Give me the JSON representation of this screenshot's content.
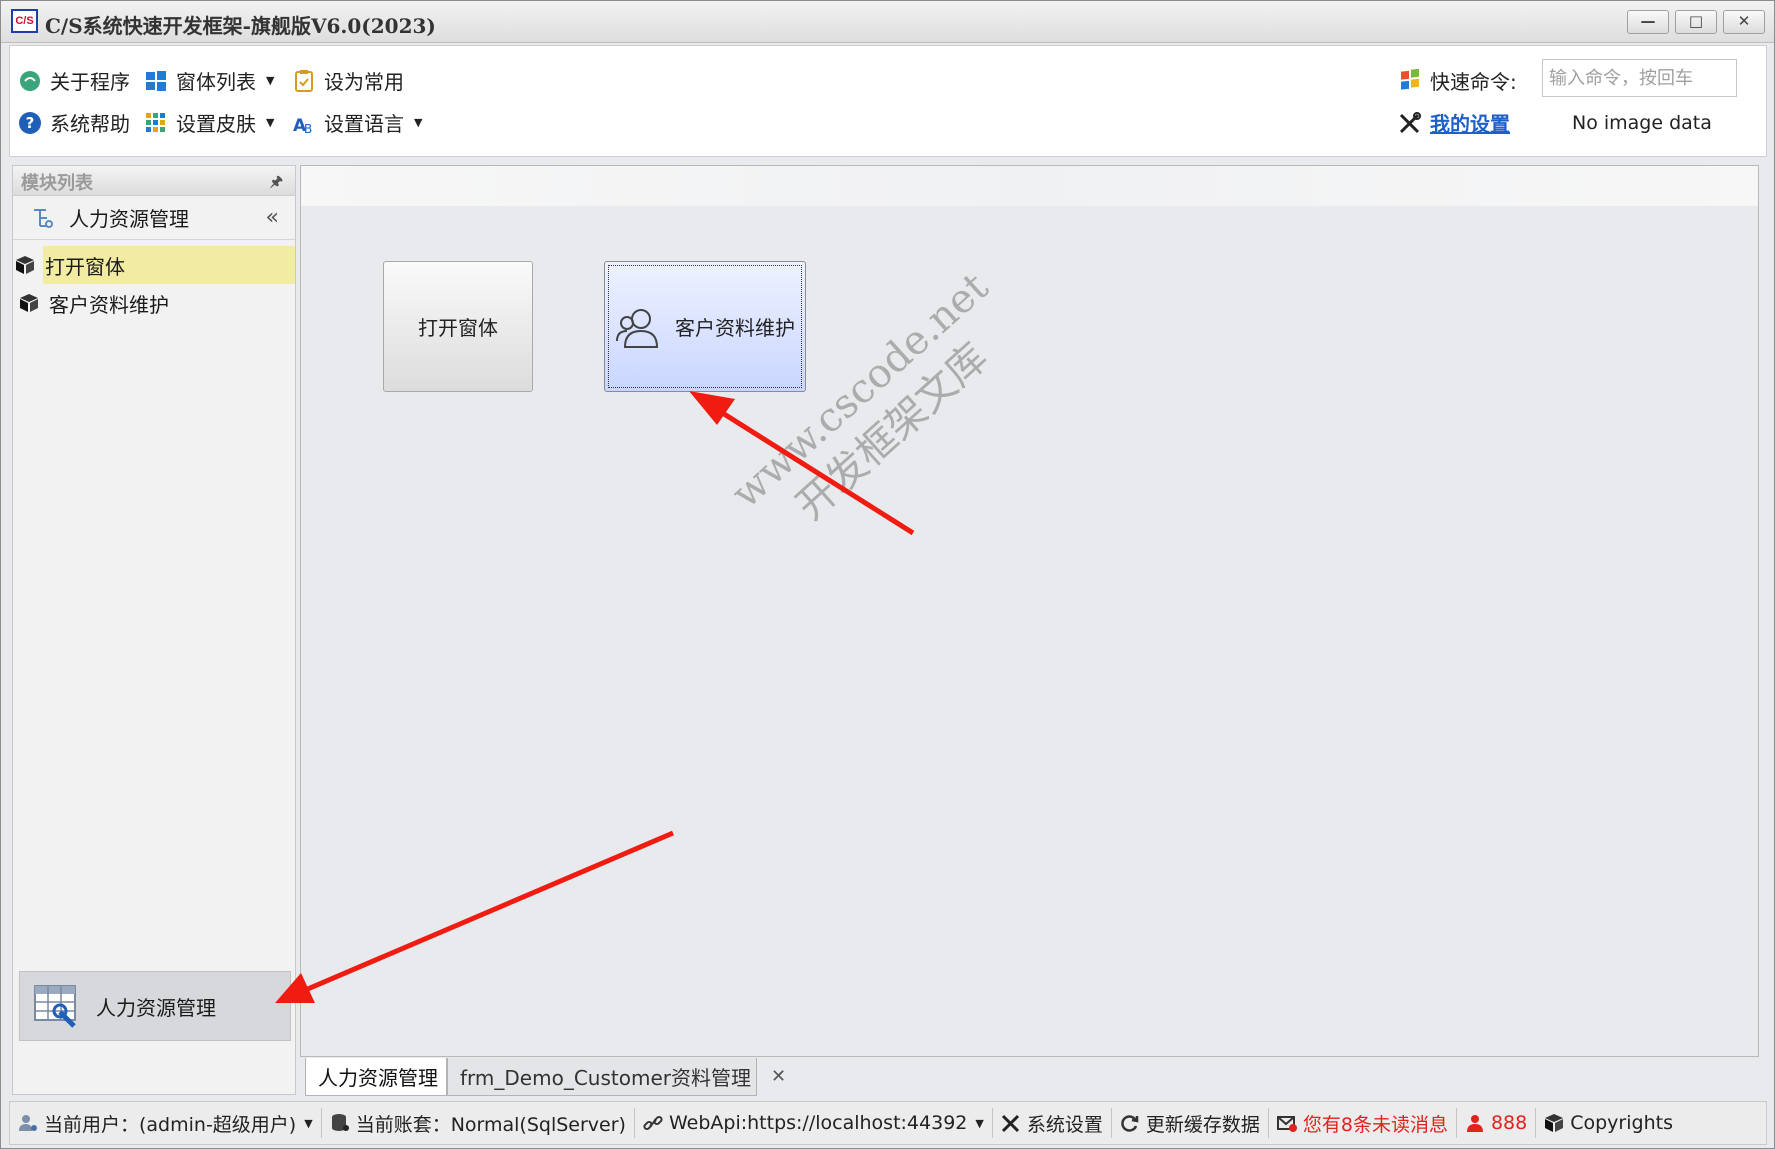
{
  "window": {
    "logo_text": "C/S",
    "title": "C/S系统快速开发框架-旗舰版V6.0(2023)",
    "minimize": "—",
    "maximize": "□",
    "close": "✕"
  },
  "toolbar": {
    "about": "关于程序",
    "form_list": "窗体列表",
    "set_common": "设为常用",
    "help": "系统帮助",
    "skin": "设置皮肤",
    "language": "设置语言",
    "quick_command_label": "快速命令:",
    "quick_command_placeholder": "输入命令，按回车",
    "my_settings": "我的设置",
    "no_image": "No image data"
  },
  "module_panel": {
    "title": "模块列表",
    "pin": "🖈",
    "group_title": "人力资源管理",
    "collapse": "«",
    "items": [
      {
        "label": "打开窗体",
        "active": true
      },
      {
        "label": "客户资料维护",
        "active": false
      }
    ],
    "bottom_group": "人力资源管理"
  },
  "main": {
    "tiles": [
      {
        "label": "打开窗体"
      },
      {
        "label": "客户资料维护"
      }
    ],
    "watermark_line1": "www.cscode.net",
    "watermark_line2": "开发框架文库"
  },
  "tabs": [
    {
      "label": "人力资源管理",
      "active": true
    },
    {
      "label": "frm_Demo_Customer资料管理",
      "active": false,
      "close": "✕"
    }
  ],
  "statusbar": {
    "user": "当前用户：(admin-超级用户)",
    "account": "当前账套：Normal(SqlServer)",
    "webapi": "WebApi:https://localhost:44392",
    "settings": "系统设置",
    "refresh_cache": "更新缓存数据",
    "unread": "您有8条未读消息",
    "count": "888",
    "copyrights": "Copyrights"
  },
  "colors": {
    "accent_red": "#e0231c",
    "link_blue": "#1f5fc8",
    "active_item": "#f1eca1",
    "tile_selected": "#c9d6ff"
  }
}
